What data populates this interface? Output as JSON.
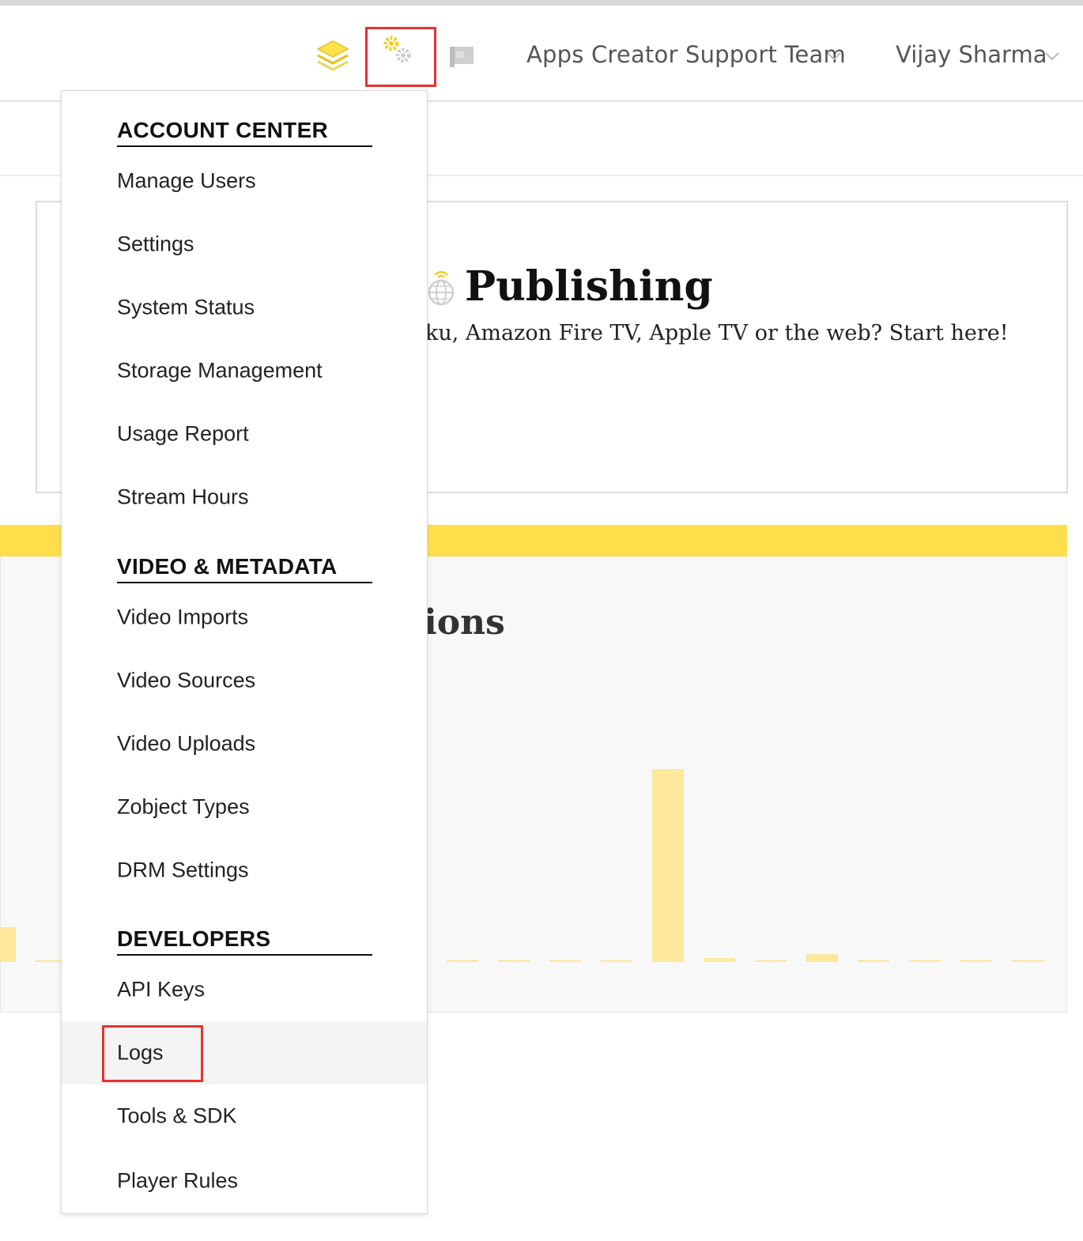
{
  "topbar": {
    "team_name": "Apps Creator Support Team",
    "user_name": "Vijay Sharma",
    "icons": [
      "layers-icon",
      "gears-icon",
      "flag-icon",
      "chevron-down-icon"
    ]
  },
  "publishing": {
    "title": "Publishing",
    "subtitle_visible": "ku, Amazon Fire TV, Apple TV or the web? Start here!"
  },
  "panel": {
    "title_visible": "ions"
  },
  "colors": {
    "accent_yellow": "#ffde4c",
    "bar_yellow": "#fde89b",
    "highlight_red": "#e8312f"
  },
  "menu": {
    "sections": [
      {
        "title": "ACCOUNT CENTER",
        "items": [
          "Manage Users",
          "Settings",
          "System Status",
          "Storage Management",
          "Usage Report",
          "Stream Hours"
        ]
      },
      {
        "title": "VIDEO & METADATA",
        "items": [
          "Video Imports",
          "Video Sources",
          "Video Uploads",
          "Zobject Types",
          "DRM Settings"
        ]
      },
      {
        "title": "DEVELOPERS",
        "items": [
          "API Keys",
          "Logs",
          "Tools & SDK",
          "Player Rules"
        ]
      }
    ],
    "active_item": "Logs"
  },
  "chart_data": {
    "type": "bar",
    "values": [
      0.18,
      0.01,
      0.01,
      0.01,
      0.01,
      0.01,
      0.01,
      0.01,
      0.01,
      0.01,
      0.01,
      0.01,
      0.01,
      1.0,
      0.02,
      0.01,
      0.04,
      0.01,
      0.01,
      0.01,
      0.01
    ],
    "ylim": [
      0,
      1
    ]
  }
}
